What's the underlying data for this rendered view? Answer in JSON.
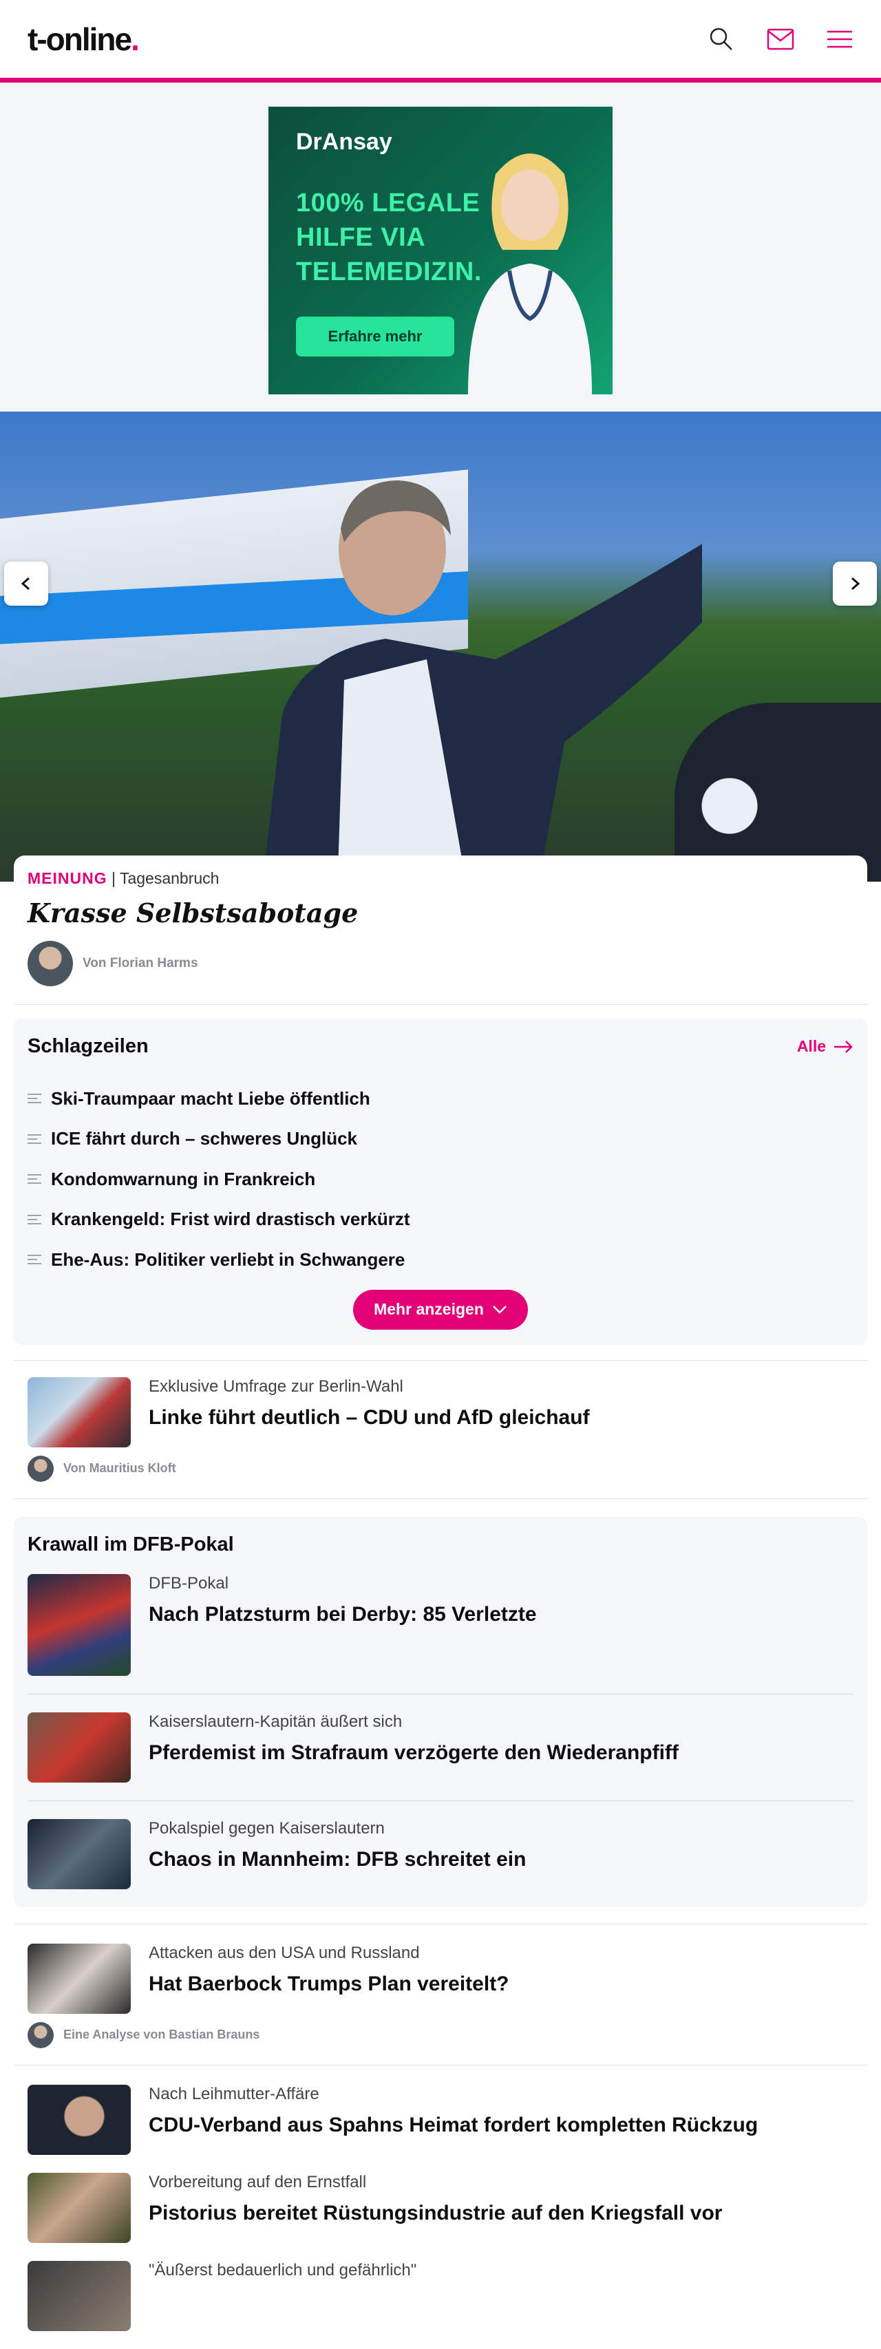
{
  "header": {
    "logo_text": "t-online",
    "logo_dot": "."
  },
  "ad": {
    "brand": "DrAnsay",
    "headline": "100% LEGALE\nHILFE VIA\nTELEMEDIZIN.",
    "cta": "Erfahre mehr"
  },
  "hero": {
    "progress_fill": 0.9
  },
  "lead": {
    "opinion": "MEINUNG",
    "section": "| Tagesanbruch",
    "title": "Krasse Selbstsabotage",
    "author": "Von Florian Harms"
  },
  "headlines": {
    "title": "Schlagzeilen",
    "all_label": "Alle",
    "items": [
      "Ski-Traumpaar macht Liebe öffentlich",
      "ICE fährt durch – schweres Unglück",
      "Kondomwarnung in Frankreich",
      "Krankengeld: Frist wird drastisch verkürzt",
      "Ehe-Aus: Politiker verliebt in Schwangere"
    ],
    "more_label": "Mehr anzeigen"
  },
  "teaser1": {
    "kicker": "Exklusive Umfrage zur Berlin-Wahl",
    "title": "Linke führt deutlich – CDU und AfD gleichauf",
    "author": "Von Mauritius Kloft"
  },
  "topic": {
    "title": "Krawall im DFB-Pokal",
    "items": [
      {
        "kicker": "DFB-Pokal",
        "title": "Nach Platzsturm bei Derby: 85 Verletzte"
      },
      {
        "kicker": "Kaiserslautern-Kapitän äußert sich",
        "title": "Pferdemist im Strafraum verzögerte den Wiederanpfiff"
      },
      {
        "kicker": "Pokalspiel gegen Kaiserslautern",
        "title": "Chaos in Mannheim: DFB schreitet ein"
      }
    ]
  },
  "feed": {
    "item1": {
      "kicker": "Attacken aus den USA und Russland",
      "title": "Hat Baerbock Trumps Plan vereitelt?",
      "author": "Eine Analyse von Bastian Brauns"
    },
    "item2": {
      "kicker": "Nach Leihmutter-Affäre",
      "title": "CDU-Verband aus Spahns Heimat fordert kompletten Rückzug"
    },
    "item3": {
      "kicker": "Vorbereitung auf den Ernstfall",
      "title": "Pistorius bereitet Rüstungsindustrie auf den Kriegsfall vor"
    },
    "item4": {
      "kicker": "\"Äußerst bedauerlich und gefährlich\""
    }
  },
  "colors": {
    "accent": "#e10075",
    "background": "#ffffff",
    "panel": "#f5f6fa"
  }
}
